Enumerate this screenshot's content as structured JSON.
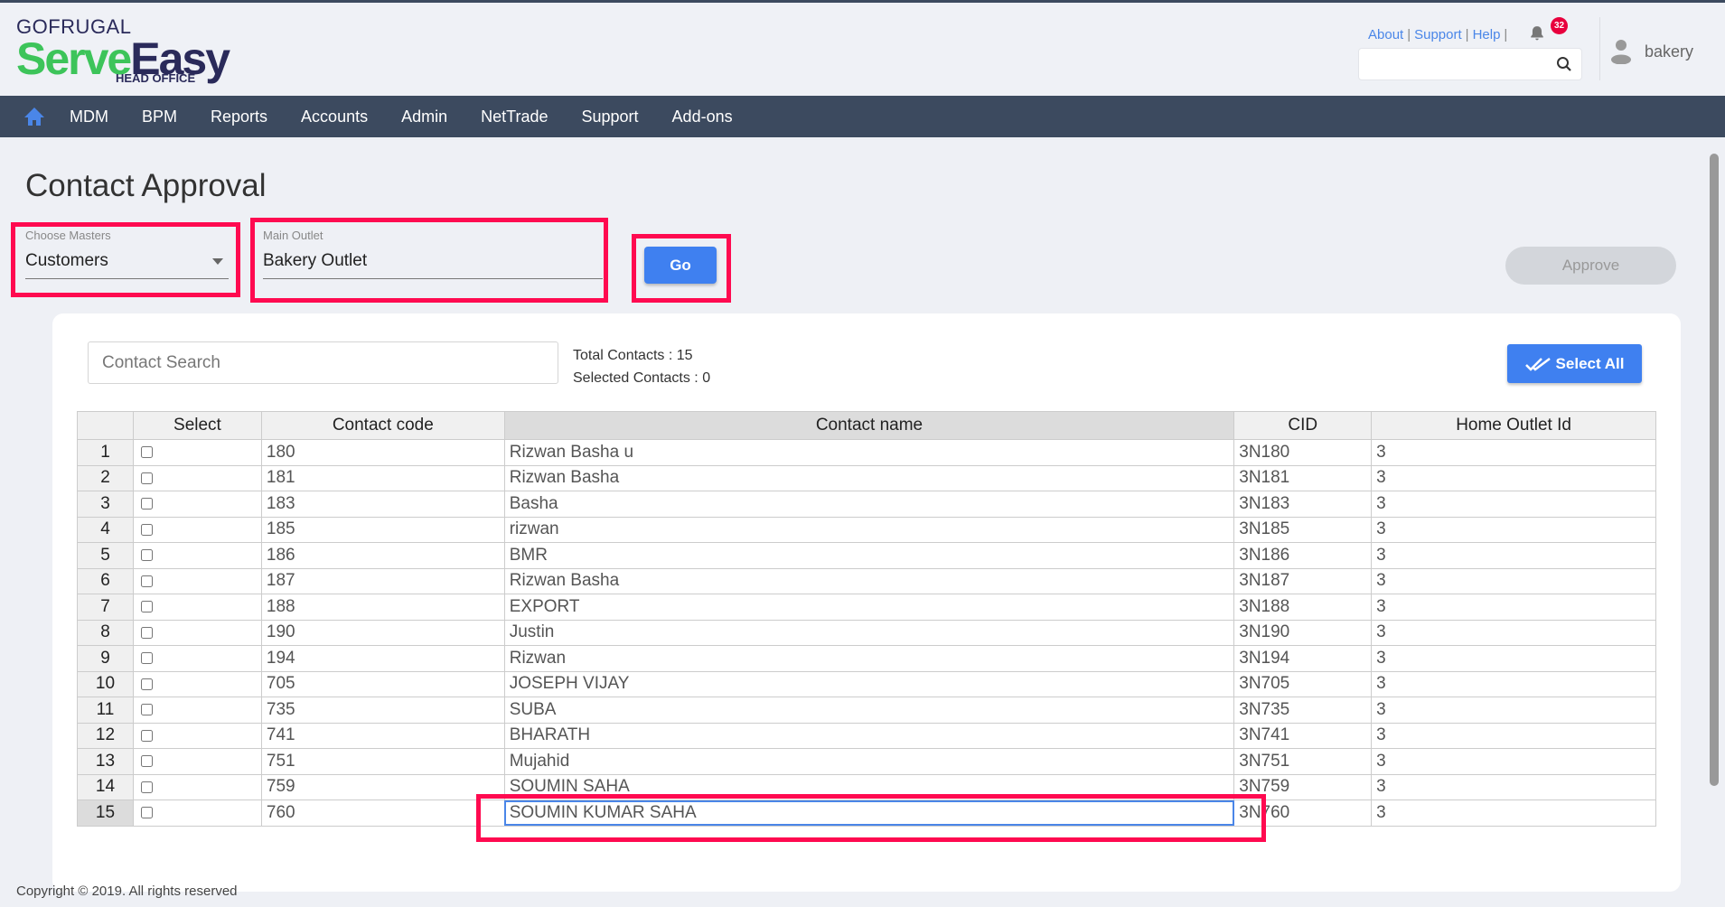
{
  "brand": {
    "company": "GOFRUGAL",
    "product_a": "Serve",
    "product_b": "Easy",
    "edition": "HEAD OFFICE"
  },
  "toplinks": {
    "about": "About",
    "support": "Support",
    "help": "Help",
    "notifications": "32"
  },
  "user": {
    "name": "bakery"
  },
  "nav": [
    "MDM",
    "BPM",
    "Reports",
    "Accounts",
    "Admin",
    "NetTrade",
    "Support",
    "Add-ons"
  ],
  "page": {
    "title": "Contact Approval"
  },
  "filters": {
    "masters_label": "Choose Masters",
    "masters_value": "Customers",
    "outlet_label": "Main Outlet",
    "outlet_value": "Bakery Outlet",
    "go": "Go",
    "approve": "Approve"
  },
  "search": {
    "placeholder": "Contact Search"
  },
  "stats": {
    "total": "Total Contacts : 15",
    "selected": "Selected Contacts : 0"
  },
  "select_all": "Select All",
  "table": {
    "headers": [
      "Select",
      "Contact code",
      "Contact name",
      "CID",
      "Home Outlet Id"
    ],
    "rows": [
      [
        "1",
        "180",
        "Rizwan Basha u",
        "3N180",
        "3"
      ],
      [
        "2",
        "181",
        "Rizwan Basha",
        "3N181",
        "3"
      ],
      [
        "3",
        "183",
        "Basha",
        "3N183",
        "3"
      ],
      [
        "4",
        "185",
        "rizwan",
        "3N185",
        "3"
      ],
      [
        "5",
        "186",
        "BMR",
        "3N186",
        "3"
      ],
      [
        "6",
        "187",
        "Rizwan Basha",
        "3N187",
        "3"
      ],
      [
        "7",
        "188",
        "EXPORT",
        "3N188",
        "3"
      ],
      [
        "8",
        "190",
        "Justin",
        "3N190",
        "3"
      ],
      [
        "9",
        "194",
        "Rizwan",
        "3N194",
        "3"
      ],
      [
        "10",
        "705",
        "JOSEPH VIJAY",
        "3N705",
        "3"
      ],
      [
        "11",
        "735",
        "SUBA",
        "3N735",
        "3"
      ],
      [
        "12",
        "741",
        "BHARATH",
        "3N741",
        "3"
      ],
      [
        "13",
        "751",
        "Mujahid",
        "3N751",
        "3"
      ],
      [
        "14",
        "759",
        "SOUMIN SAHA",
        "3N759",
        "3"
      ],
      [
        "15",
        "760",
        "SOUMIN KUMAR SAHA",
        "3N760",
        "3"
      ]
    ]
  },
  "footer": "Copyright © 2019. All rights reserved"
}
